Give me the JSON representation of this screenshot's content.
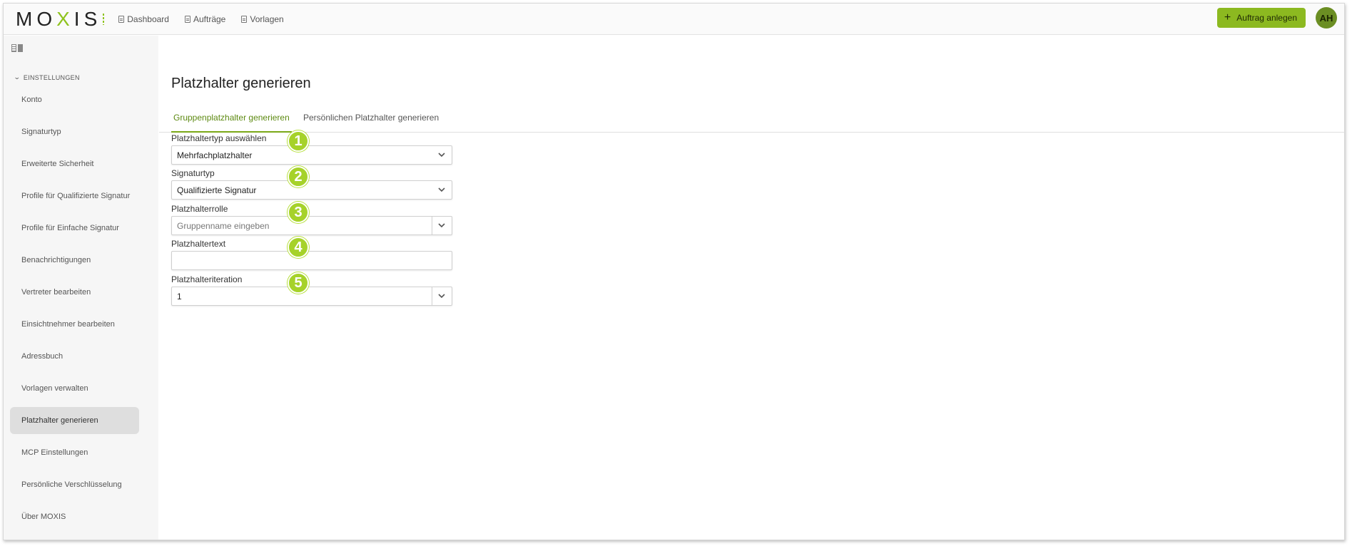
{
  "topbar": {
    "logo_main": "MO",
    "logo_x": "X",
    "logo_end": "IS",
    "nav": [
      {
        "label": "Dashboard",
        "icon": "document-icon"
      },
      {
        "label": "Aufträge",
        "icon": "document-icon"
      },
      {
        "label": "Vorlagen",
        "icon": "document-icon"
      }
    ],
    "new_order_label": "Auftrag anlegen",
    "avatar_initials": "AH"
  },
  "sidebar": {
    "section_label": "EINSTELLUNGEN",
    "items": [
      {
        "label": "Konto"
      },
      {
        "label": "Signaturtyp"
      },
      {
        "label": "Erweiterte Sicherheit"
      },
      {
        "label": "Profile für Qualifizierte Signatur"
      },
      {
        "label": "Profile für Einfache Signatur"
      },
      {
        "label": "Benachrichtigungen"
      },
      {
        "label": "Vertreter bearbeiten"
      },
      {
        "label": "Einsichtnehmer bearbeiten"
      },
      {
        "label": "Adressbuch"
      },
      {
        "label": "Vorlagen verwalten"
      },
      {
        "label": "Platzhalter generieren",
        "active": true
      },
      {
        "label": "MCP Einstellungen"
      },
      {
        "label": "Persönliche Verschlüsselung"
      },
      {
        "label": "Über MOXIS"
      }
    ]
  },
  "main": {
    "title": "Platzhalter generieren",
    "tabs": [
      {
        "label": "Gruppenplatzhalter generieren",
        "active": true
      },
      {
        "label": "Persönlichen Platzhalter generieren",
        "active": false
      }
    ],
    "form": {
      "type_label": "Platzhaltertyp auswählen",
      "type_value": "Mehrfachplatzhalter",
      "signature_label": "Signaturtyp",
      "signature_value": "Qualifizierte Signatur",
      "role_label": "Platzhalterrolle",
      "role_placeholder": "Gruppenname eingeben",
      "text_label": "Platzhaltertext",
      "text_value": "",
      "iteration_label": "Platzhalteriteration",
      "iteration_value": "1"
    },
    "markers": [
      "1",
      "2",
      "3",
      "4",
      "5"
    ]
  },
  "colors": {
    "accent": "#8cb920",
    "marker": "#a6d22a",
    "active_tab": "#5d8a12"
  }
}
